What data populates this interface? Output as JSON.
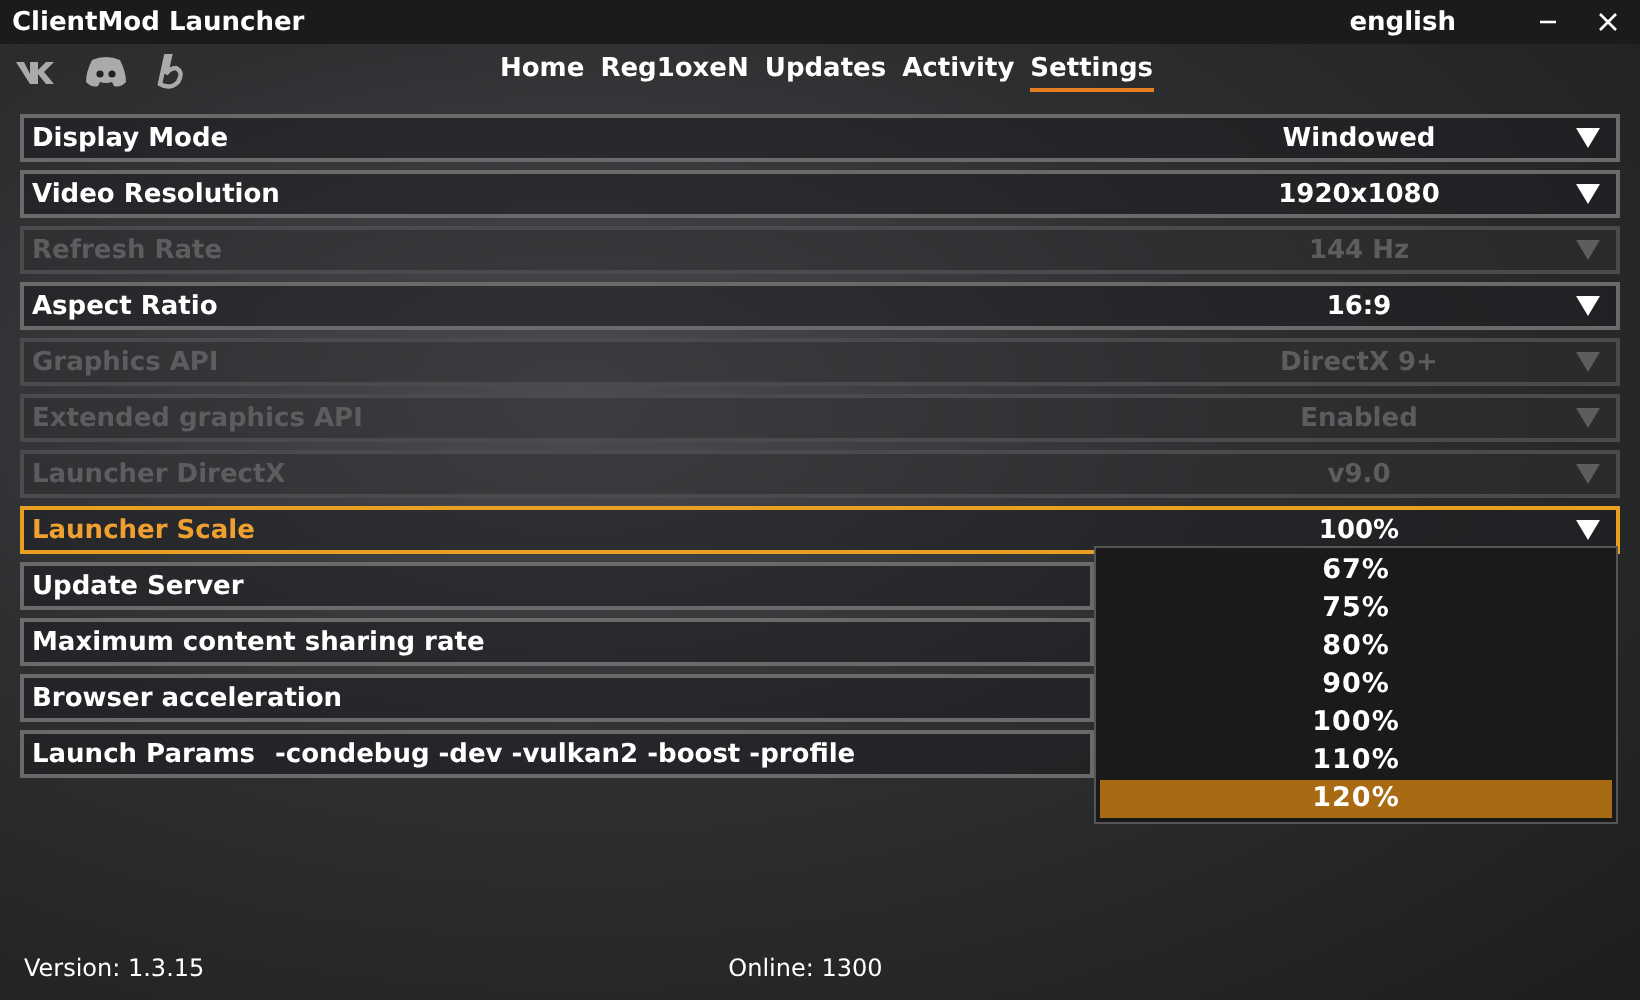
{
  "window": {
    "title": "ClientMod Launcher",
    "language": "english"
  },
  "nav": [
    {
      "label": "Home",
      "selected": false
    },
    {
      "label": "Reg1oxeN",
      "selected": false
    },
    {
      "label": "Updates",
      "selected": false
    },
    {
      "label": "Activity",
      "selected": false
    },
    {
      "label": "Settings",
      "selected": true
    }
  ],
  "settings": [
    {
      "kind": "select",
      "label": "Display Mode",
      "value": "Windowed",
      "disabled": false,
      "open": false
    },
    {
      "kind": "select",
      "label": "Video Resolution",
      "value": "1920x1080",
      "disabled": false,
      "open": false
    },
    {
      "kind": "select",
      "label": "Refresh Rate",
      "value": "144 Hz",
      "disabled": true,
      "open": false
    },
    {
      "kind": "select",
      "label": "Aspect Ratio",
      "value": "16:9",
      "disabled": false,
      "open": false
    },
    {
      "kind": "select",
      "label": "Graphics API",
      "value": "DirectX 9+",
      "disabled": true,
      "open": false
    },
    {
      "kind": "select",
      "label": "Extended graphics API",
      "value": "Enabled",
      "disabled": true,
      "open": false
    },
    {
      "kind": "select",
      "label": "Launcher DirectX",
      "value": "v9.0",
      "disabled": true,
      "open": false
    },
    {
      "kind": "select",
      "label": "Launcher Scale",
      "value": "100%",
      "disabled": false,
      "open": true
    },
    {
      "kind": "select",
      "label": "Update Server",
      "disabled": false,
      "open": false
    },
    {
      "kind": "select",
      "label": "Maximum content sharing rate",
      "disabled": false,
      "open": false
    },
    {
      "kind": "select",
      "label": "Browser acceleration",
      "disabled": false,
      "open": false
    },
    {
      "kind": "text",
      "label": "Launch Params",
      "value": "-condebug -dev -vulkan2 -boost -profile"
    }
  ],
  "dropdown_options": [
    {
      "label": "67%",
      "selected": false
    },
    {
      "label": "75%",
      "selected": false
    },
    {
      "label": "80%",
      "selected": false
    },
    {
      "label": "90%",
      "selected": false
    },
    {
      "label": "100%",
      "selected": false
    },
    {
      "label": "110%",
      "selected": false
    },
    {
      "label": "120%",
      "selected": true
    }
  ],
  "status_bar": {
    "version": "Version: 1.3.15",
    "online": "Online: 1300"
  }
}
